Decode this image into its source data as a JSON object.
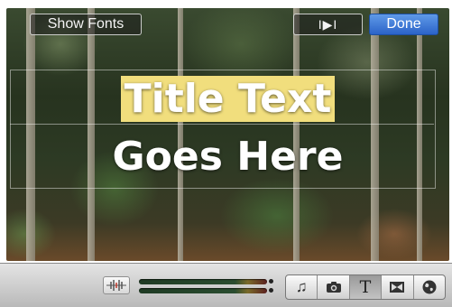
{
  "viewer": {
    "show_fonts_label": "Show Fonts",
    "play_label": "I▶I",
    "done_label": "Done",
    "title_line1": "Title Text",
    "title_line2": "Goes Here"
  },
  "toolbar": {
    "browser_buttons": [
      {
        "name": "music-icon",
        "glyph": "♫",
        "selected": false
      },
      {
        "name": "camera-icon",
        "glyph": "📷",
        "selected": false
      },
      {
        "name": "title-text-icon",
        "glyph": "T",
        "selected": true
      },
      {
        "name": "transition-icon",
        "glyph": "⊠",
        "selected": false
      },
      {
        "name": "globe-icon",
        "glyph": "◕",
        "selected": false
      }
    ]
  },
  "colors": {
    "highlight": "#f1de7d",
    "done_button": "#3b74d8"
  }
}
